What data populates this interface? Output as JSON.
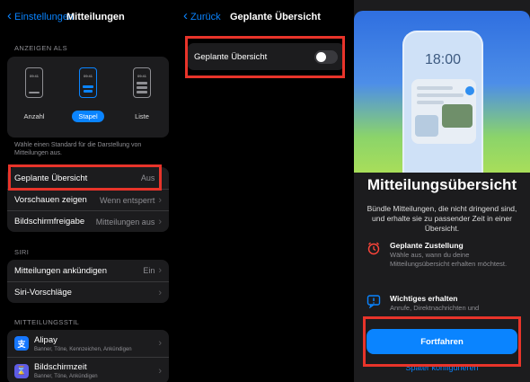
{
  "panel1": {
    "back_label": "Einstellungen",
    "title": "Mitteilungen",
    "display_header": "ANZEIGEN ALS",
    "phone_time": "09:41",
    "display_options": [
      "Anzahl",
      "Stapel",
      "Liste"
    ],
    "selected_option": "Stapel",
    "display_note": "Wähle einen Standard für die Darstellung von Mitteilungen aus.",
    "rows": [
      {
        "label": "Geplante Übersicht",
        "value": "Aus"
      },
      {
        "label": "Vorschauen zeigen",
        "value": "Wenn entsperrt"
      },
      {
        "label": "Bildschirmfreigabe",
        "value": "Mitteilungen aus"
      }
    ],
    "siri_header": "SIRI",
    "siri_rows": [
      {
        "label": "Mitteilungen ankündigen",
        "value": "Ein"
      },
      {
        "label": "Siri-Vorschläge",
        "value": ""
      }
    ],
    "style_header": "MITTEILUNGSSTIL",
    "apps": [
      {
        "name": "Alipay",
        "sub": "Banner, Töne, Kennzeichen, Ankündigen",
        "color": "#1677ff"
      },
      {
        "name": "Bildschirmzeit",
        "sub": "Banner, Töne, Ankündigen",
        "color": "#5e5ce6"
      }
    ]
  },
  "panel2": {
    "back_label": "Zurück",
    "title": "Geplante Übersicht",
    "toggle_label": "Geplante Übersicht",
    "toggle_state": "off"
  },
  "panel3": {
    "hero_time": "18:00",
    "title": "Mitteilungsübersicht",
    "description": "Bündle Mitteilungen, die nicht dringend sind, und erhalte sie zu passender Zeit in einer Übersicht.",
    "features": [
      {
        "title": "Geplante Zustellung",
        "text": "Wähle aus, wann du deine Mitteilungsübersicht erhalten möchtest.",
        "icon": "alarm-clock-icon"
      },
      {
        "title": "Wichtiges erhalten",
        "text": "Anrufe, Direktnachrichten und",
        "icon": "message-alert-icon"
      }
    ],
    "continue_label": "Fortfahren",
    "later_label": "Später konfigurieren"
  },
  "colors": {
    "accent": "#0a84ff",
    "highlight": "#e8342a"
  }
}
